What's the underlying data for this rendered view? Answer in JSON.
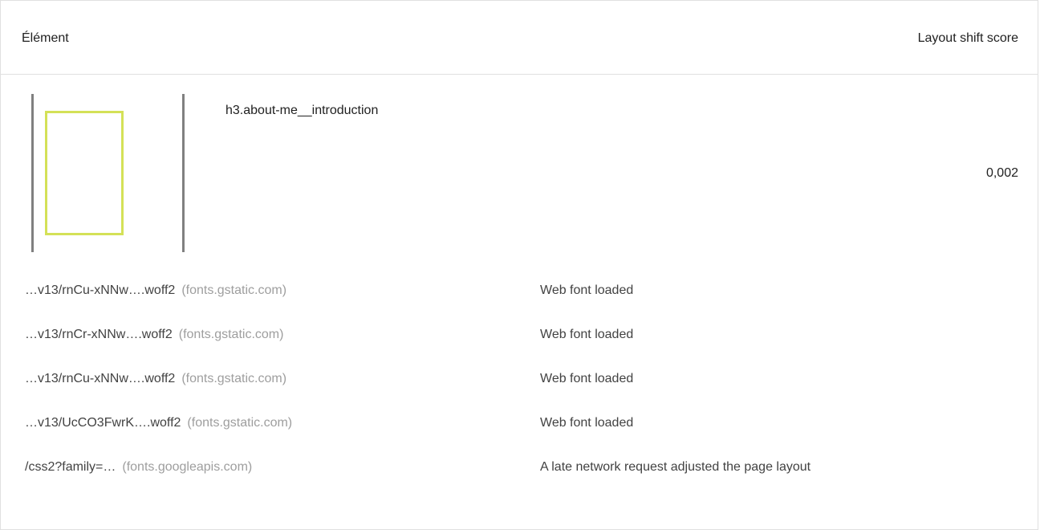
{
  "table": {
    "header": {
      "element_label": "Élément",
      "score_label": "Layout shift score"
    },
    "item": {
      "node_label": "h3.about-me__introduction",
      "score": "0,002"
    },
    "subitems": [
      {
        "url": "…v13/rnCu-xNNw….woff2",
        "host": "(fonts.gstatic.com)",
        "reason": "Web font loaded"
      },
      {
        "url": "…v13/rnCr-xNNw….woff2",
        "host": "(fonts.gstatic.com)",
        "reason": "Web font loaded"
      },
      {
        "url": "…v13/rnCu-xNNw….woff2",
        "host": "(fonts.gstatic.com)",
        "reason": "Web font loaded"
      },
      {
        "url": "…v13/UcCO3FwrK….woff2",
        "host": "(fonts.gstatic.com)",
        "reason": "Web font loaded"
      },
      {
        "url": "/css2?family=…",
        "host": "(fonts.googleapis.com)",
        "reason": "A late network request adjusted the page layout"
      }
    ]
  },
  "colors": {
    "shift_highlight": "#d4e157",
    "thumb_border": "#808080",
    "host_text": "#9e9e9e",
    "divider": "#e0e0e0"
  }
}
